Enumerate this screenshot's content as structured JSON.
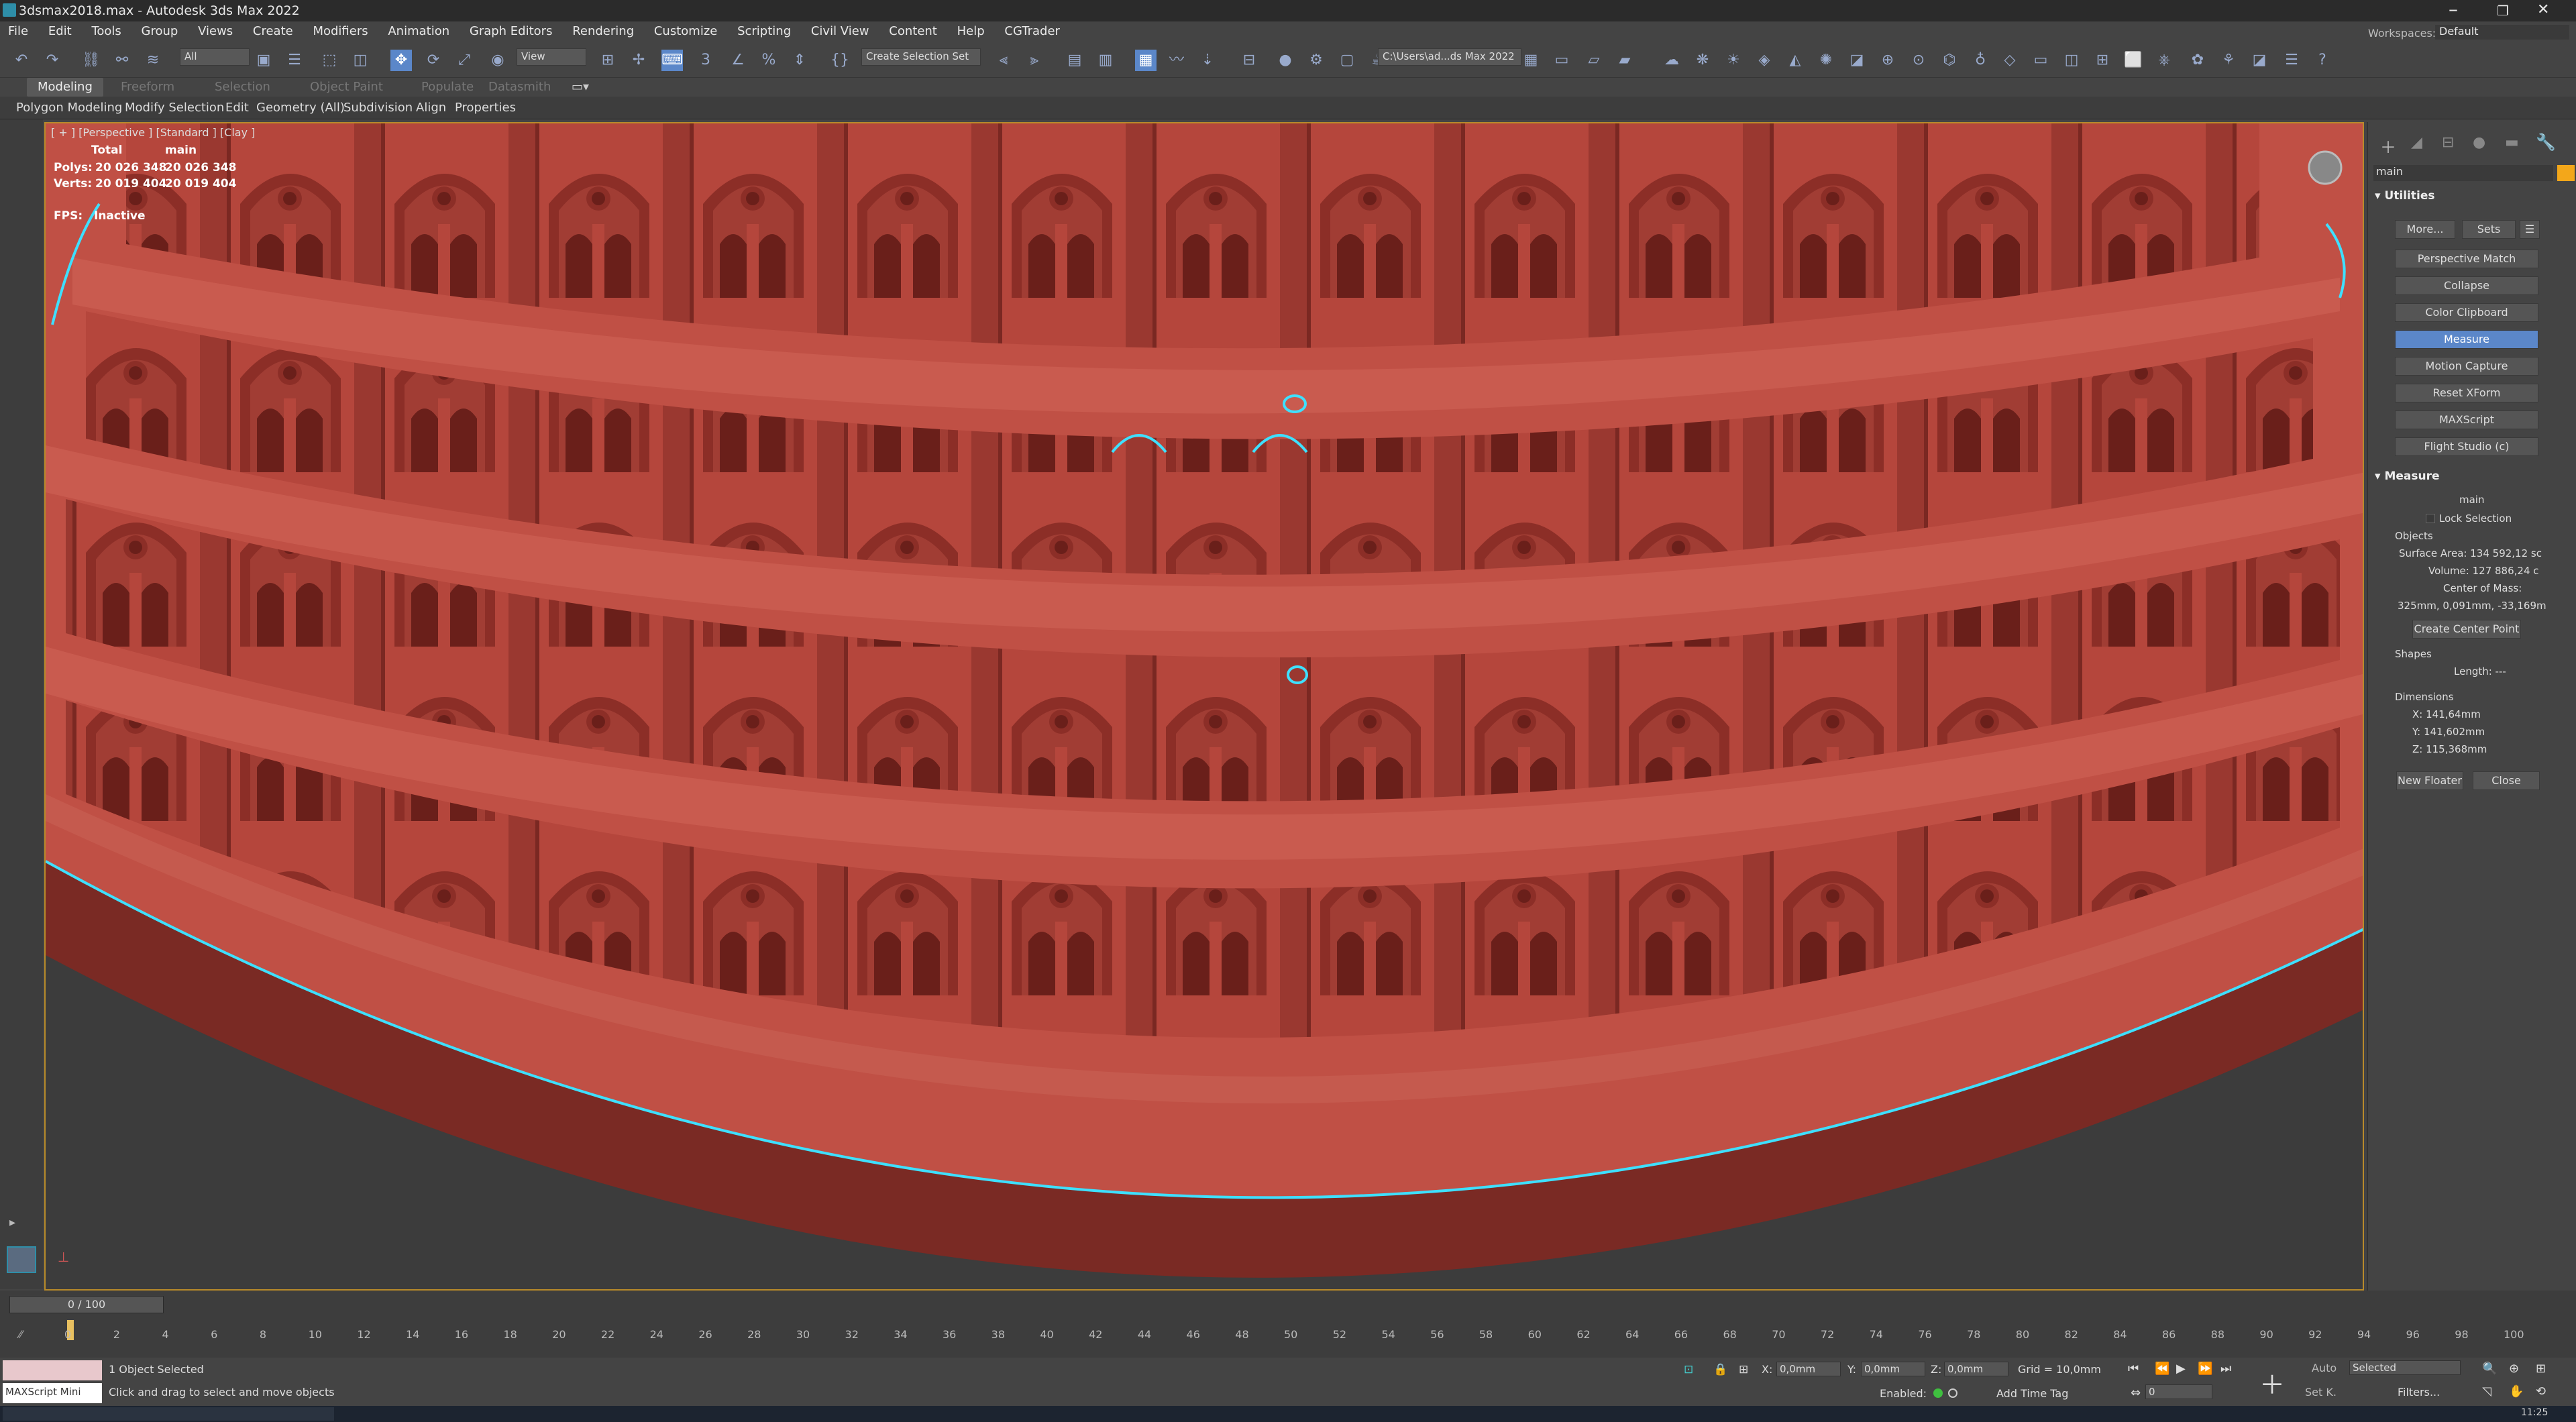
{
  "window": {
    "title": "3dsmax2018.max - Autodesk 3ds Max 2022",
    "workspaces_label": "Workspaces:",
    "workspace_value": "Default"
  },
  "menu": [
    "File",
    "Edit",
    "Tools",
    "Group",
    "Views",
    "Create",
    "Modifiers",
    "Animation",
    "Graph Editors",
    "Rendering",
    "Customize",
    "Scripting",
    "Civil View",
    "Content",
    "Help",
    "CGTrader"
  ],
  "toolbar": {
    "selection_filter": "All",
    "view_dropdown": "View",
    "named_selection": "Create Selection Set",
    "project_path": "C:\\Users\\ad...ds Max 2022"
  },
  "ribbon_tabs": [
    "Modeling",
    "Freeform",
    "Selection",
    "Object Paint",
    "Populate",
    "Datasmith"
  ],
  "ribbon_sub": [
    "Polygon Modeling",
    "Modify Selection",
    "Edit",
    "Geometry (All)",
    "Subdivision",
    "Align",
    "Properties"
  ],
  "viewport": {
    "label": "[ + ] [Perspective ] [Standard ] [Clay ]",
    "stats_total": "Total",
    "stats_main": "main",
    "polys_label": "Polys:",
    "polys_total": "20 026 348",
    "polys_main": "20 026 348",
    "verts_label": "Verts:",
    "verts_total": "20 019 404",
    "verts_main": "20 019 404",
    "fps_label": "FPS:",
    "fps_value": "Inactive"
  },
  "command_panel": {
    "object_name": "main",
    "utilities_title": "Utilities",
    "more_btn": "More...",
    "sets_btn": "Sets",
    "utility_buttons": [
      "Perspective Match",
      "Collapse",
      "Color Clipboard",
      "Measure",
      "Motion Capture",
      "Reset XForm",
      "MAXScript",
      "Flight Studio (c)"
    ],
    "selected_utility": "Measure",
    "measure_title": "Measure",
    "measure_object": "main",
    "lock_selection": "Lock Selection",
    "objects_label": "Objects",
    "surface_area": "Surface Area: 134 592,12 sc",
    "volume": "Volume: 127 886,24 c",
    "center_of_mass_label": "Center of Mass:",
    "center_of_mass": "325mm, 0,091mm, -33,169m",
    "create_center_point": "Create Center Point",
    "shapes_label": "Shapes",
    "length": "Length: ---",
    "dimensions_label": "Dimensions",
    "dim_x": "X:  141,64mm",
    "dim_y": "Y:  141,602mm",
    "dim_z": "Z:  115,368mm",
    "new_floater": "New Floater",
    "close": "Close"
  },
  "timeline": {
    "frame": "0 / 100",
    "ticks": [
      "0",
      "2",
      "4",
      "6",
      "8",
      "10",
      "12",
      "14",
      "16",
      "18",
      "20",
      "22",
      "24",
      "26",
      "28",
      "30",
      "32",
      "34",
      "36",
      "38",
      "40",
      "42",
      "44",
      "46",
      "48",
      "50",
      "52",
      "54",
      "56",
      "58",
      "60",
      "62",
      "64",
      "66",
      "68",
      "70",
      "72",
      "74",
      "76",
      "78",
      "80",
      "82",
      "84",
      "86",
      "88",
      "90",
      "92",
      "94",
      "96",
      "98",
      "100"
    ]
  },
  "status": {
    "selected": "1 Object Selected",
    "prompt": "Click and drag to select and move objects",
    "maxscript": "MAXScript Mini",
    "x_label": "X:",
    "x_value": "0,0mm",
    "y_label": "Y:",
    "y_value": "0,0mm",
    "z_label": "Z:",
    "z_value": "0,0mm",
    "grid": "Grid = 10,0mm",
    "enabled": "Enabled:",
    "add_time_tag": "Add Time Tag",
    "auto": "Auto",
    "set_k": "Set K.",
    "key_filter": "Selected",
    "filters": "Filters...",
    "frame_field": "0"
  },
  "taskbar": {
    "clock": "11:25"
  },
  "colors": {
    "model": "#b5463c",
    "model_dark": "#8c2e27",
    "selection": "#3ee0ff",
    "active_btn": "#5b87c9"
  }
}
